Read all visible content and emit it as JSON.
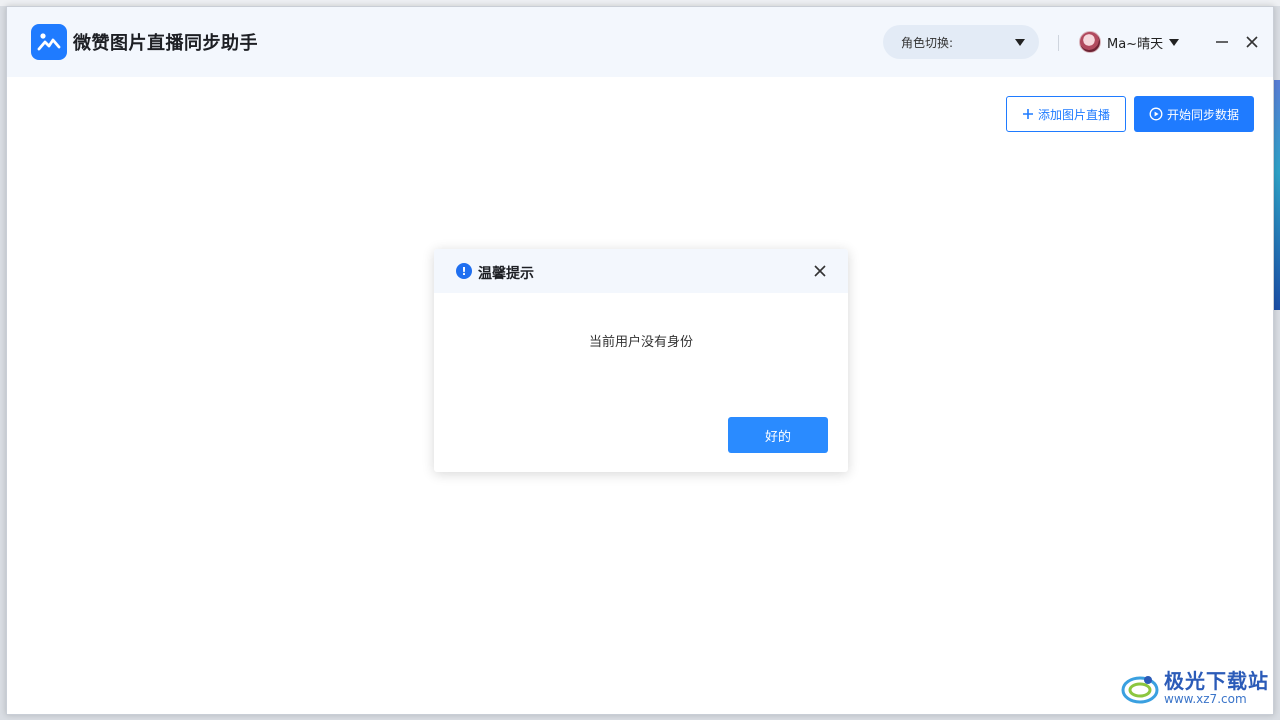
{
  "app": {
    "title": "微赞图片直播同步助手"
  },
  "header": {
    "role_switch_label": "角色切换:",
    "username": "Ma~晴天"
  },
  "toolbar": {
    "add_label": "添加图片直播",
    "sync_label": "开始同步数据"
  },
  "dialog": {
    "title": "温馨提示",
    "message": "当前用户没有身份",
    "ok_label": "好的"
  },
  "watermark": {
    "title": "极光下载站",
    "url": "www.xz7.com"
  },
  "colors": {
    "primary": "#1f7bff",
    "header_bg": "#f3f7fd"
  }
}
